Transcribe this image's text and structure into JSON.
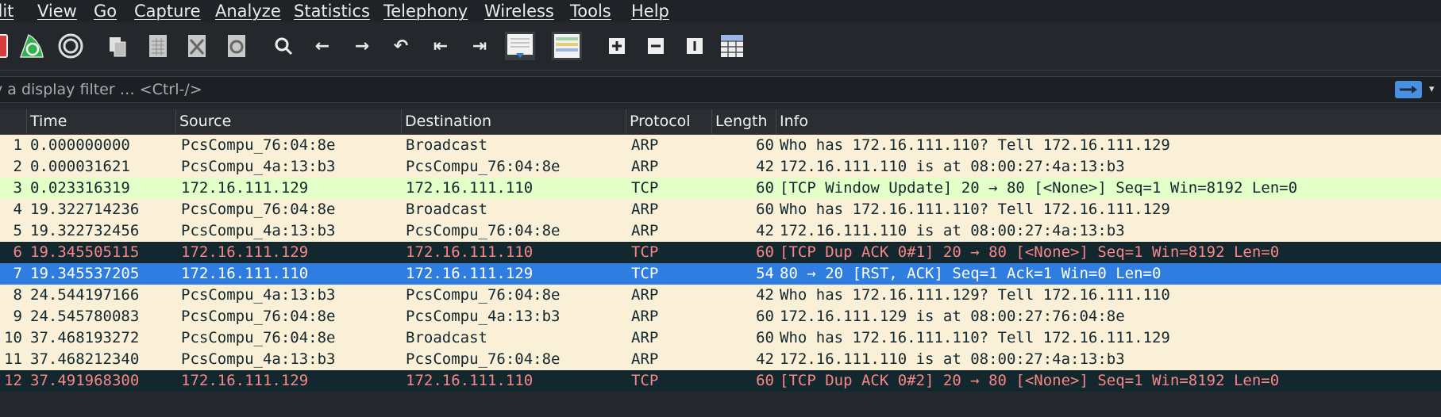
{
  "menu": [
    "dit",
    "View",
    "Go",
    "Capture",
    "Analyze",
    "Statistics",
    "Telephony",
    "Wireless",
    "Tools",
    "Help"
  ],
  "filter": {
    "placeholder": "y a display filter … <Ctrl-/>"
  },
  "columns": {
    "time": "Time",
    "source": "Source",
    "destination": "Destination",
    "protocol": "Protocol",
    "length": "Length",
    "info": "Info"
  },
  "colors": {
    "arp_bg": "#faf0d7",
    "arp_fg": "#12272e",
    "tcp_bg": "#e7e6ff",
    "tcp_green_bg": "#e4ffc7",
    "dup_bg": "#12272e",
    "dup_fg": "#f78787",
    "selected_bg": "#2f7de1",
    "selected_fg": "#ffffff"
  },
  "packets": [
    {
      "no": "1",
      "time": "0.000000000",
      "source": "PcsCompu_76:04:8e",
      "destination": "Broadcast",
      "protocol": "ARP",
      "length": "60",
      "info": "Who has 172.16.111.110? Tell 172.16.111.129",
      "style": "arp"
    },
    {
      "no": "2",
      "time": "0.000031621",
      "source": "PcsCompu_4a:13:b3",
      "destination": "PcsCompu_76:04:8e",
      "protocol": "ARP",
      "length": "42",
      "info": "172.16.111.110 is at 08:00:27:4a:13:b3",
      "style": "arp"
    },
    {
      "no": "3",
      "time": "0.023316319",
      "source": "172.16.111.129",
      "destination": "172.16.111.110",
      "protocol": "TCP",
      "length": "60",
      "info": "[TCP Window Update] 20 → 80 [<None>] Seq=1 Win=8192 Len=0",
      "style": "tcpgreen"
    },
    {
      "no": "4",
      "time": "19.322714236",
      "source": "PcsCompu_76:04:8e",
      "destination": "Broadcast",
      "protocol": "ARP",
      "length": "60",
      "info": "Who has 172.16.111.110? Tell 172.16.111.129",
      "style": "arp"
    },
    {
      "no": "5",
      "time": "19.322732456",
      "source": "PcsCompu_4a:13:b3",
      "destination": "PcsCompu_76:04:8e",
      "protocol": "ARP",
      "length": "42",
      "info": "172.16.111.110 is at 08:00:27:4a:13:b3",
      "style": "arp"
    },
    {
      "no": "6",
      "time": "19.345505115",
      "source": "172.16.111.129",
      "destination": "172.16.111.110",
      "protocol": "TCP",
      "length": "60",
      "info": "[TCP Dup ACK 0#1] 20 → 80 [<None>] Seq=1 Win=8192 Len=0",
      "style": "dup"
    },
    {
      "no": "7",
      "time": "19.345537205",
      "source": "172.16.111.110",
      "destination": "172.16.111.129",
      "protocol": "TCP",
      "length": "54",
      "info": "80 → 20 [RST, ACK] Seq=1 Ack=1 Win=0 Len=0",
      "style": "selected"
    },
    {
      "no": "8",
      "time": "24.544197166",
      "source": "PcsCompu_4a:13:b3",
      "destination": "PcsCompu_76:04:8e",
      "protocol": "ARP",
      "length": "42",
      "info": "Who has 172.16.111.129? Tell 172.16.111.110",
      "style": "arp"
    },
    {
      "no": "9",
      "time": "24.545780083",
      "source": "PcsCompu_76:04:8e",
      "destination": "PcsCompu_4a:13:b3",
      "protocol": "ARP",
      "length": "60",
      "info": "172.16.111.129 is at 08:00:27:76:04:8e",
      "style": "arp"
    },
    {
      "no": "10",
      "time": "37.468193272",
      "source": "PcsCompu_76:04:8e",
      "destination": "Broadcast",
      "protocol": "ARP",
      "length": "60",
      "info": "Who has 172.16.111.110? Tell 172.16.111.129",
      "style": "arp"
    },
    {
      "no": "11",
      "time": "37.468212340",
      "source": "PcsCompu_4a:13:b3",
      "destination": "PcsCompu_76:04:8e",
      "protocol": "ARP",
      "length": "42",
      "info": "172.16.111.110 is at 08:00:27:4a:13:b3",
      "style": "arp"
    },
    {
      "no": "12",
      "time": "37.491968300",
      "source": "172.16.111.129",
      "destination": "172.16.111.110",
      "protocol": "TCP",
      "length": "60",
      "info": "[TCP Dup ACK 0#2] 20 → 80 [<None>] Seq=1 Win=8192 Len=0",
      "style": "dup"
    }
  ]
}
